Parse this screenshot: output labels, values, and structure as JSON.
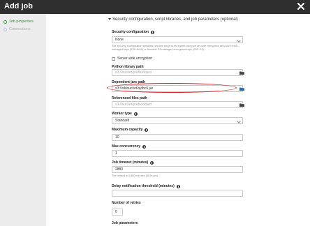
{
  "window": {
    "title": "Add job"
  },
  "sidebar": {
    "steps": [
      {
        "label": "Job properties",
        "active": true
      },
      {
        "label": "Connections",
        "active": false
      }
    ]
  },
  "section": {
    "title": "Security configuration, script libraries, and job parameters (optional)"
  },
  "fields": {
    "security_configuration": {
      "label": "Security configuration",
      "value": "None",
      "help": "The security configuration specifies how the script is encrypted using server-side encryption with AWS KMS-managed keys (SSE-KMS) or Amazon S3-managed encryption keys (SSE-S3)."
    },
    "server_side_encryption": {
      "label": "Server-side encryption",
      "checked": false
    },
    "python_library_path": {
      "label": "Python library path",
      "placeholder": "s3://bucket/prefix/object"
    },
    "dependent_jars_path": {
      "label": "Dependent jars path",
      "value": "s3://rdsbucket/ojdbc6.jar"
    },
    "referenced_files_path": {
      "label": "Referenced files path",
      "placeholder": "s3://bucket/prefix/object"
    },
    "worker_type": {
      "label": "Worker type",
      "value": "Standard"
    },
    "maximum_capacity": {
      "label": "Maximum capacity",
      "value": "10"
    },
    "max_concurrency": {
      "label": "Max concurrency",
      "value": "1"
    },
    "job_timeout": {
      "label": "Job timeout (minutes)",
      "value": "2880",
      "help": "The default is 2,880 minutes (48 hours)."
    },
    "delay_notification_threshold": {
      "label": "Delay notification threshold (minutes)",
      "value": ""
    },
    "number_of_retries": {
      "label": "Number of retries",
      "value": "0"
    },
    "job_parameters": {
      "label": "Job parameters"
    }
  },
  "colors": {
    "titlebar": "#2f2f2f",
    "active_step": "#3a8f3a",
    "highlight": "#d42626"
  },
  "icons": {
    "close": "close-icon",
    "folder": "folder-icon",
    "info": "info-icon"
  }
}
